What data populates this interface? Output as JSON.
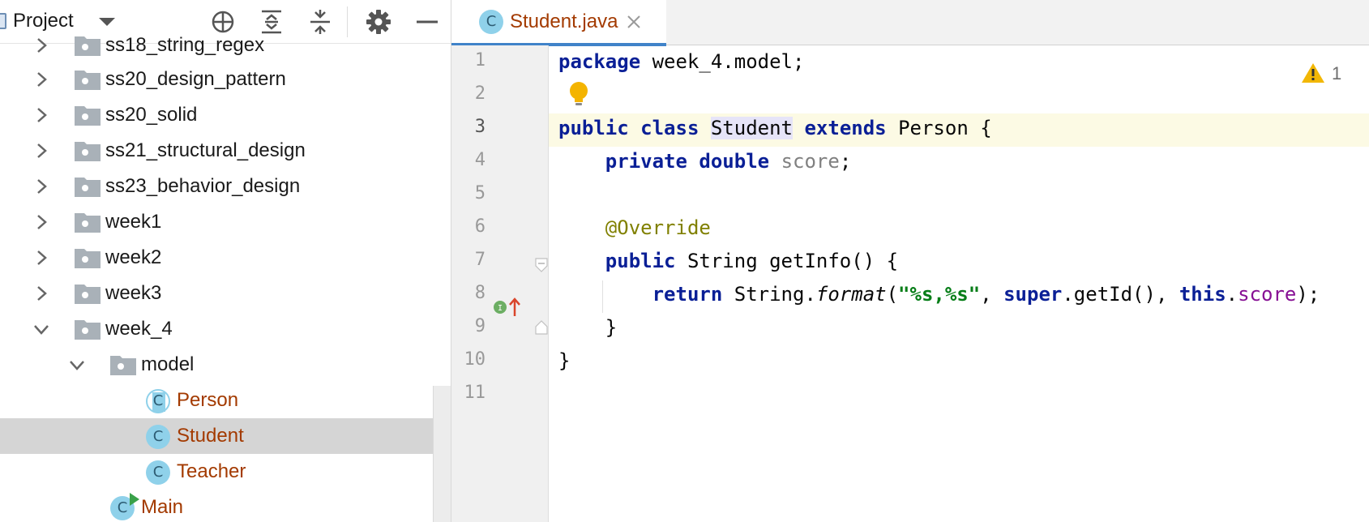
{
  "project_panel": {
    "title": "Project",
    "toolbar": {
      "locate": "locate-icon",
      "expand_all": "expand-all-icon",
      "collapse_all": "collapse-all-icon",
      "settings": "gear-icon",
      "hide": "minimize-icon"
    },
    "tree": [
      {
        "label": "ss18_string_regex",
        "kind": "folder",
        "expanded": false
      },
      {
        "label": "ss20_design_pattern",
        "kind": "folder",
        "expanded": false
      },
      {
        "label": "ss20_solid",
        "kind": "folder",
        "expanded": false
      },
      {
        "label": "ss21_structural_design",
        "kind": "folder",
        "expanded": false
      },
      {
        "label": "ss23_behavior_design",
        "kind": "folder",
        "expanded": false
      },
      {
        "label": "week1",
        "kind": "folder",
        "expanded": false
      },
      {
        "label": "week2",
        "kind": "folder",
        "expanded": false
      },
      {
        "label": "week3",
        "kind": "folder",
        "expanded": false
      },
      {
        "label": "week_4",
        "kind": "folder",
        "expanded": true
      },
      {
        "label": "model",
        "kind": "package",
        "expanded": true
      },
      {
        "label": "Person",
        "kind": "abstract-class"
      },
      {
        "label": "Student",
        "kind": "class",
        "selected": true
      },
      {
        "label": "Teacher",
        "kind": "class"
      },
      {
        "label": "Main",
        "kind": "runnable-class"
      }
    ]
  },
  "editor": {
    "tab": {
      "label": "Student.java",
      "icon_letter": "C"
    },
    "line_numbers": [
      "1",
      "2",
      "3",
      "4",
      "5",
      "6",
      "7",
      "8",
      "9",
      "10",
      "11"
    ],
    "code": {
      "l1": {
        "kw": "package",
        "rest": " week_4.model;"
      },
      "l3": {
        "kw1": "public",
        "kw2": "class",
        "name": "Student",
        "kw3": "extends",
        "rest": " Person {"
      },
      "l4": {
        "kw1": "private",
        "kw2": "double",
        "field": "score",
        "end": ";"
      },
      "l6": {
        "annotation": "@Override"
      },
      "l7": {
        "kw": "public",
        "rest": " String getInfo() {"
      },
      "l8": {
        "kw": "return",
        "a": " String.",
        "method": "format",
        "b": "(",
        "str": "\"%s,%s\"",
        "c": ", ",
        "kw2": "super",
        "d": ".getId(), ",
        "kw3": "this",
        "e": ".",
        "field": "score",
        "f": ");"
      },
      "l9": {
        "text": "}"
      },
      "l10": {
        "text": "}"
      }
    },
    "warnings": {
      "count": "1"
    },
    "colors": {
      "keyword": "#0a1f96",
      "string": "#067d17",
      "annotation": "#808000",
      "class_name": "#a33a00",
      "tab_underline": "#4083c9"
    }
  }
}
